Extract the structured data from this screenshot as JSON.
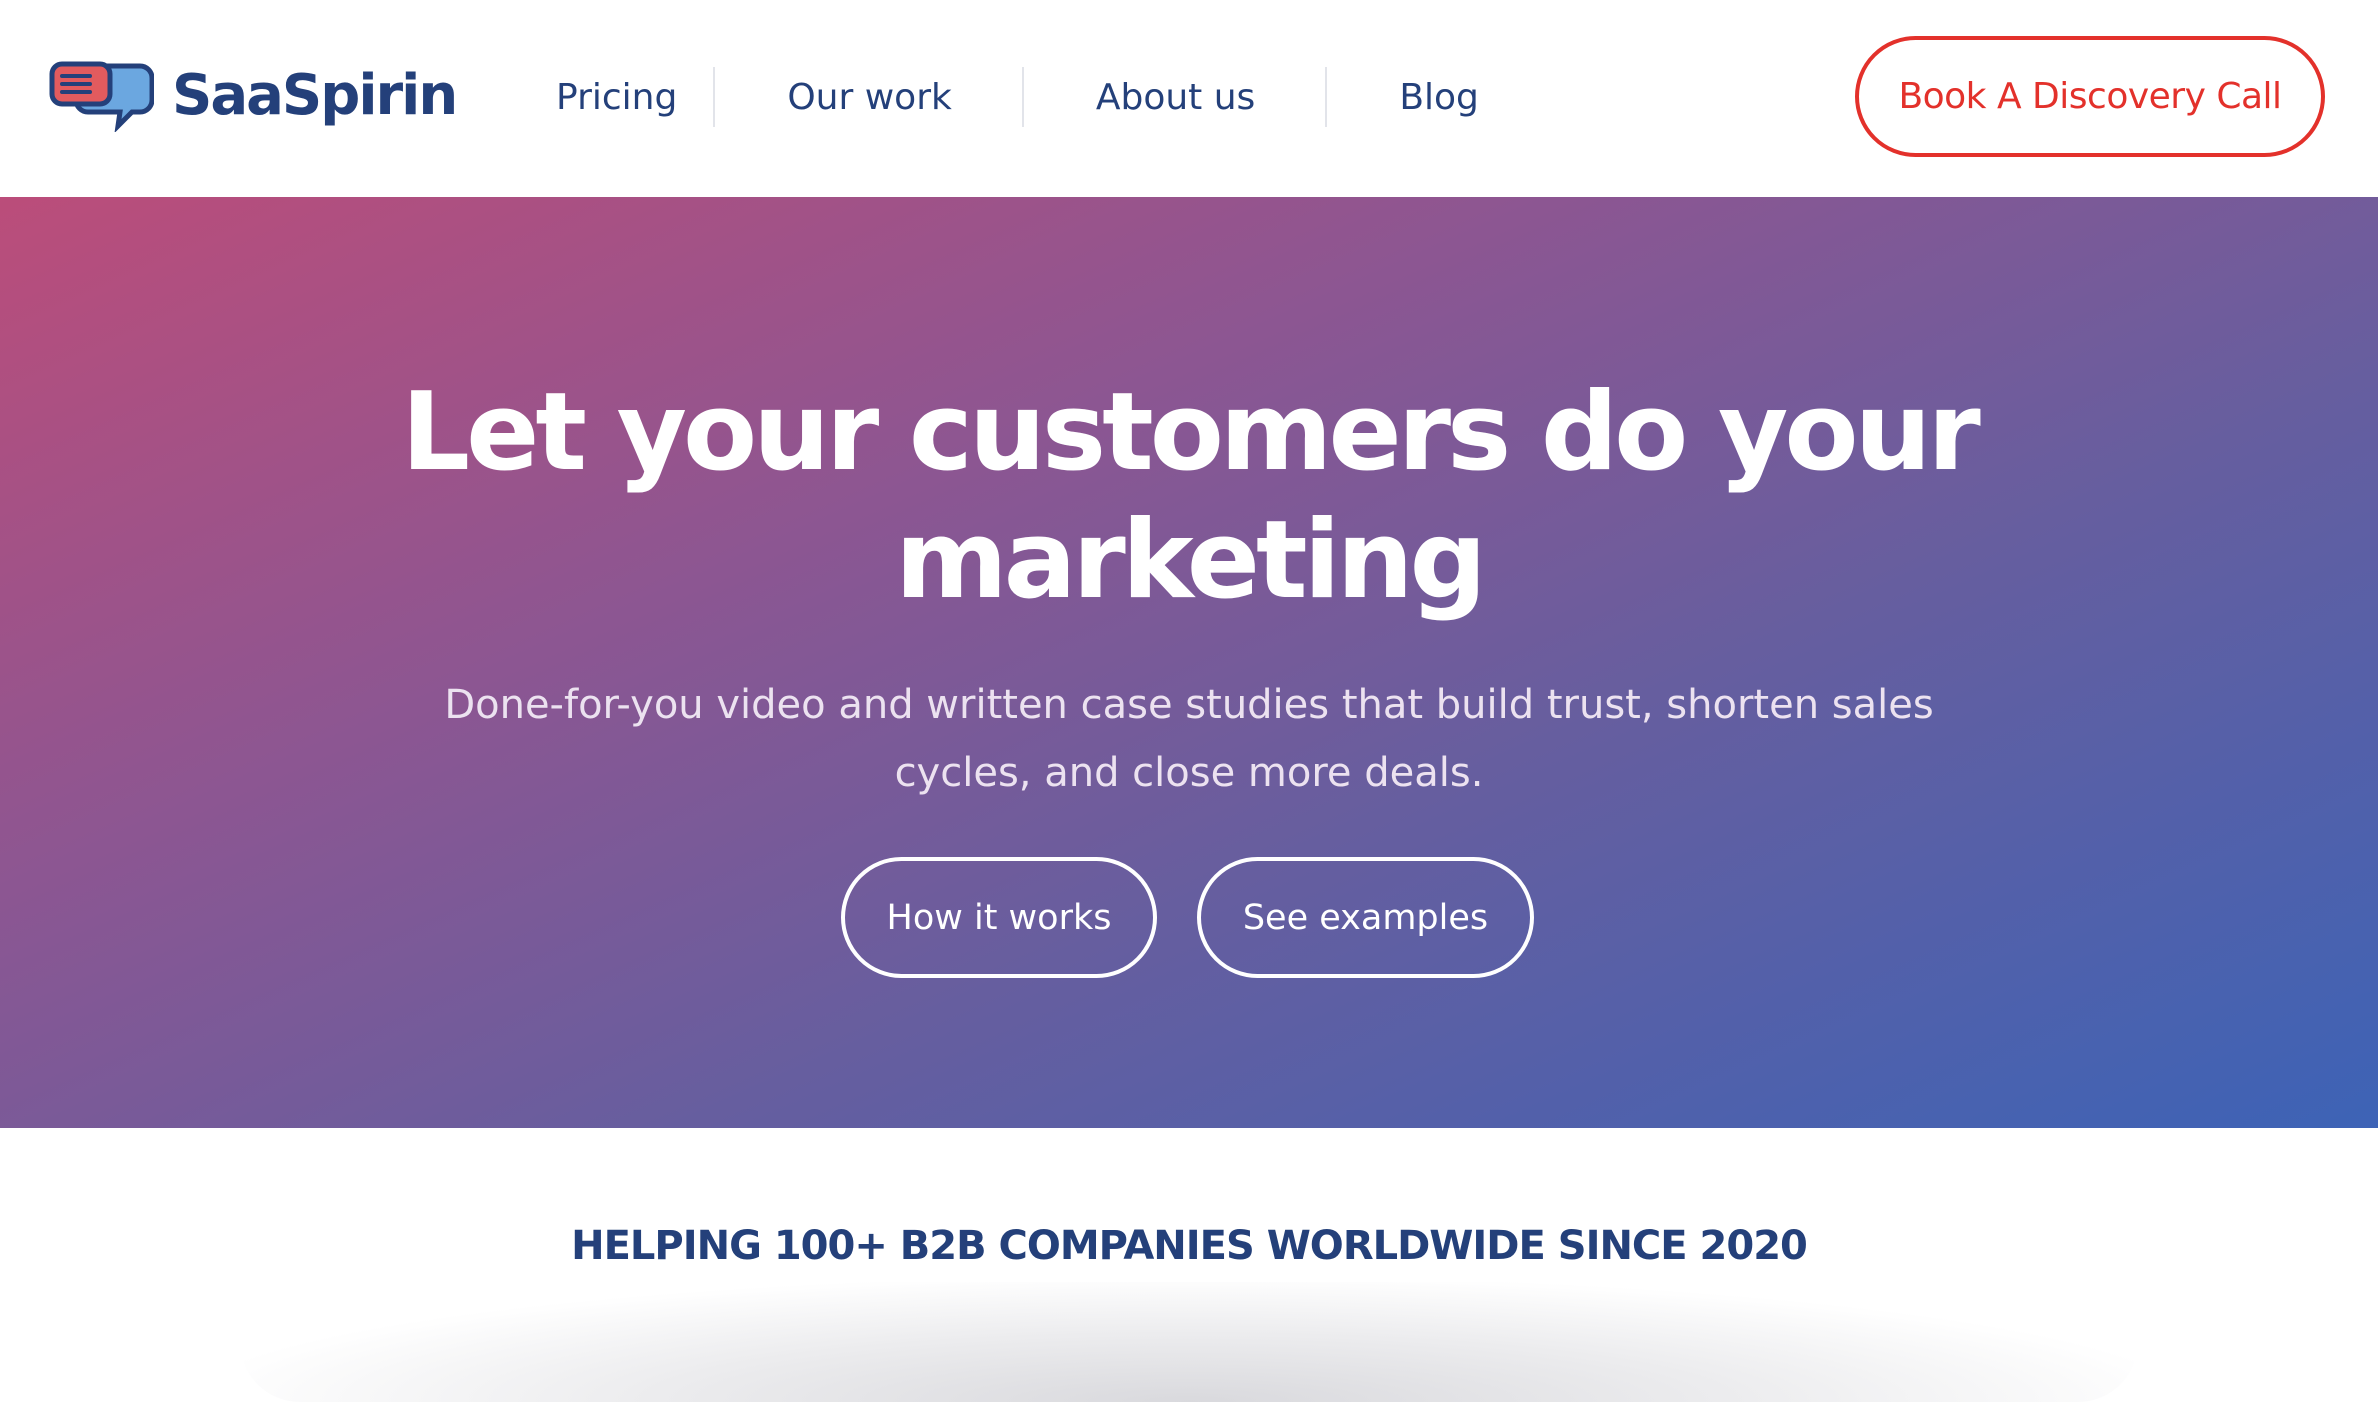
{
  "brand": {
    "name": "SaaSpirin",
    "logo_icon": "speech-bubbles-icon",
    "colors": {
      "navy": "#24407a",
      "red": "#e3312b",
      "light_blue": "#6ba7e0"
    }
  },
  "nav": {
    "items": [
      {
        "label": "Pricing"
      },
      {
        "label": "Our work"
      },
      {
        "label": "About us"
      },
      {
        "label": "Blog"
      }
    ],
    "cta_label": "Book A Discovery Call"
  },
  "hero": {
    "title_line1": "Let your customers do your",
    "title_line2": "marketing",
    "subtitle": "Done-for-you video and written case studies that build trust, shorten sales cycles, and close more deals.",
    "buttons": [
      {
        "label": "How it works"
      },
      {
        "label": "See examples"
      }
    ],
    "gradient_colors": [
      "#bb4d7a",
      "#8c5692",
      "#665e9f",
      "#3d63b6"
    ]
  },
  "trust": {
    "headline": "HELPING 100+ B2B COMPANIES WORLDWIDE SINCE 2020"
  }
}
